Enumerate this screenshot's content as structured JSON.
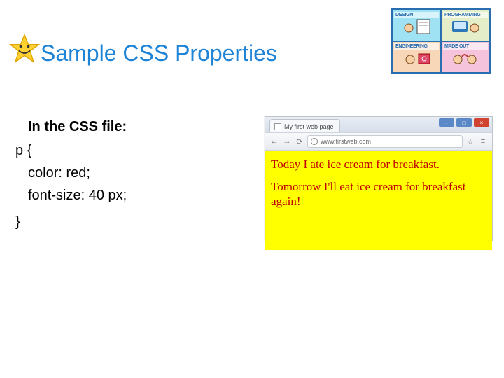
{
  "title": "Sample CSS Properties",
  "corner": {
    "a": "DESIGN",
    "b": "PROGRAMMING",
    "c": "ENGINEERING",
    "d": "MADE OUT"
  },
  "code": {
    "heading": "In the CSS file:",
    "selector": "p {",
    "prop1": "color: red;",
    "prop2": "font-size: 40 px;",
    "close": "}"
  },
  "browser": {
    "tab_title": "My first web page",
    "url": "www.firstweb.com",
    "nav": {
      "back": "←",
      "fwd": "→",
      "reload": "⟳",
      "menu": "≡",
      "star": "☆"
    },
    "wc": {
      "min": "–",
      "max": "□",
      "close": "×"
    },
    "page": {
      "line1": "Today I ate ice cream for breakfast.",
      "line2": "Tomorrow I'll eat ice cream for breakfast again!"
    }
  }
}
